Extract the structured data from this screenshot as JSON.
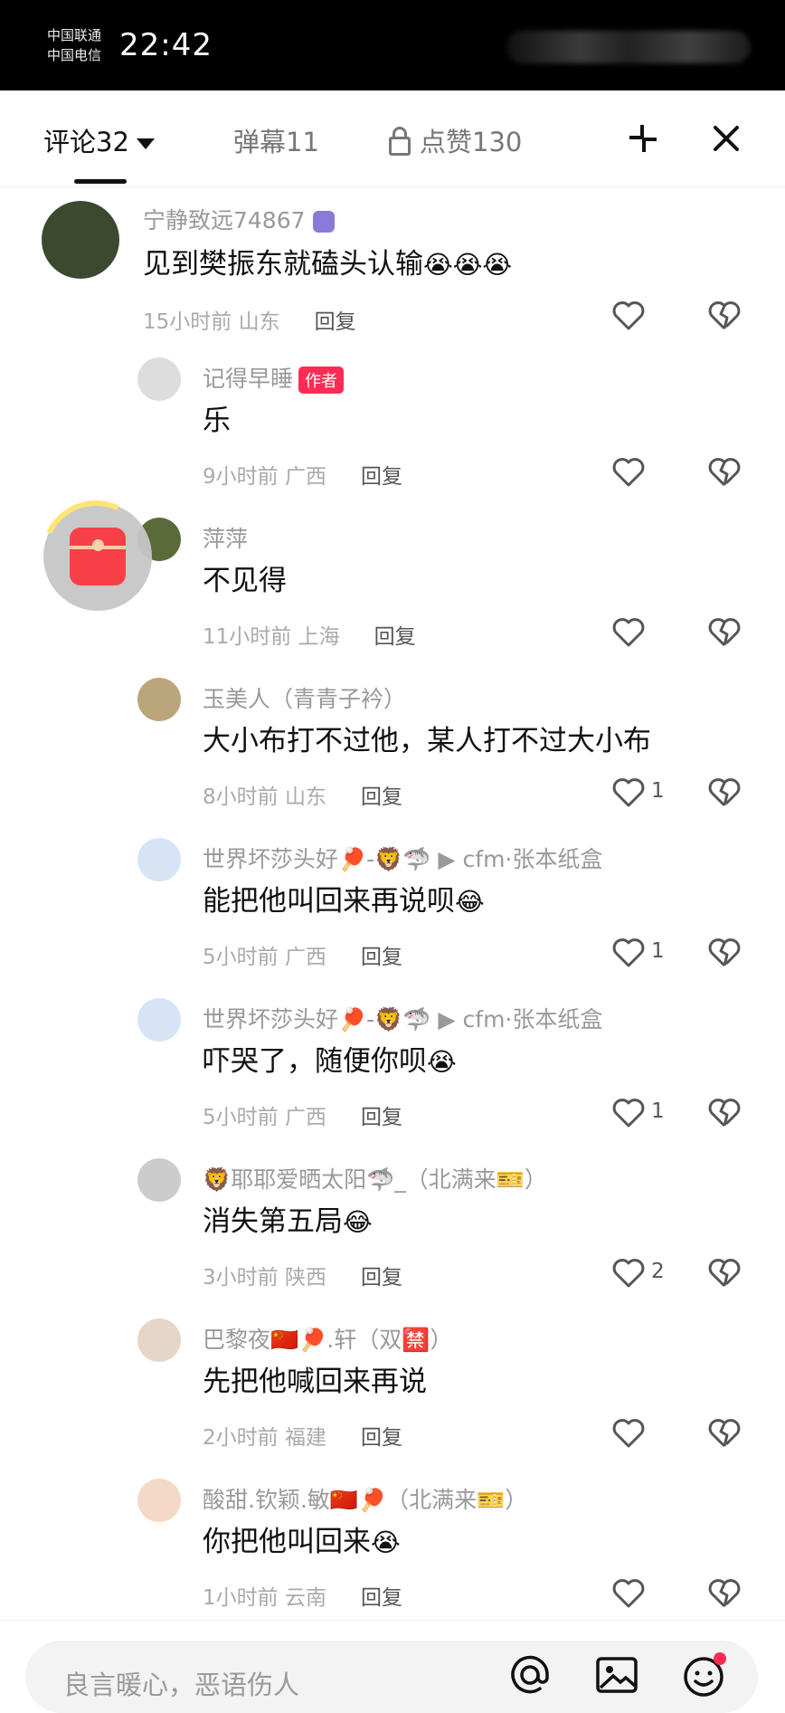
{
  "status_bar": {
    "carrier_1": "中国联通",
    "carrier_2": "中国电信",
    "time": "22:42"
  },
  "tabs": [
    {
      "label": "评论32"
    },
    {
      "label": "弹幕11"
    },
    {
      "label": "点赞130"
    }
  ],
  "author_badge": "作者",
  "reply_label": "回复",
  "comments": [
    {
      "user": "宁静致远74867",
      "text": "见到樊振东就磕头认输",
      "emoji": "😭😭😭",
      "time": "15小时前",
      "location": "山东",
      "likes": ""
    },
    {
      "user": "记得早睡",
      "text": "乐",
      "emoji": "",
      "time": "9小时前",
      "location": "广西",
      "likes": ""
    },
    {
      "user": "萍萍",
      "text": "不见得",
      "emoji": "",
      "time": "11小时前",
      "location": "上海",
      "likes": ""
    },
    {
      "user": "玉美人（青青子衿）",
      "text": "大小布打不过他，某人打不过大小布",
      "emoji": "",
      "time": "8小时前",
      "location": "山东",
      "likes": "1"
    },
    {
      "user": "世界坏莎头好🏓-🦁🦈 ▶ cfm·张本纸盒",
      "text": "能把他叫回来再说呗",
      "emoji": "😂",
      "time": "5小时前",
      "location": "广西",
      "likes": "1"
    },
    {
      "user": "世界坏莎头好🏓-🦁🦈 ▶ cfm·张本纸盒",
      "text": "吓哭了，随便你呗",
      "emoji": "😭",
      "time": "5小时前",
      "location": "广西",
      "likes": "1"
    },
    {
      "user": "🦁耶耶爱晒太阳🦈_（北满来🎫）",
      "text": "消失第五局",
      "emoji": "😂",
      "time": "3小时前",
      "location": "陕西",
      "likes": "2"
    },
    {
      "user": "巴黎夜🇨🇳🏓.轩（双🈲）",
      "text": "先把他喊回来再说",
      "emoji": "",
      "time": "2小时前",
      "location": "福建",
      "likes": ""
    },
    {
      "user": "酸甜.钦颖.敏🇨🇳🏓（北满来🎫）",
      "text": "你把他叫回来",
      "emoji": "😭",
      "time": "1小时前",
      "location": "云南",
      "likes": ""
    }
  ],
  "input": {
    "placeholder": "良言暖心，恶语伤人"
  },
  "colors": {
    "accent_badge": "#fe2c55",
    "name_gray": "#999999",
    "status_bar_bg": "#000000"
  }
}
